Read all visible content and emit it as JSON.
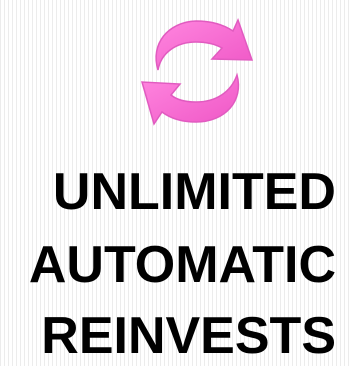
{
  "icon": {
    "name": "refresh-cycle-icon",
    "color": "#f66bd0"
  },
  "headline": {
    "line1": "UNLIMITED",
    "line2": "AUTOMATIC",
    "line3": "REINVESTS"
  }
}
